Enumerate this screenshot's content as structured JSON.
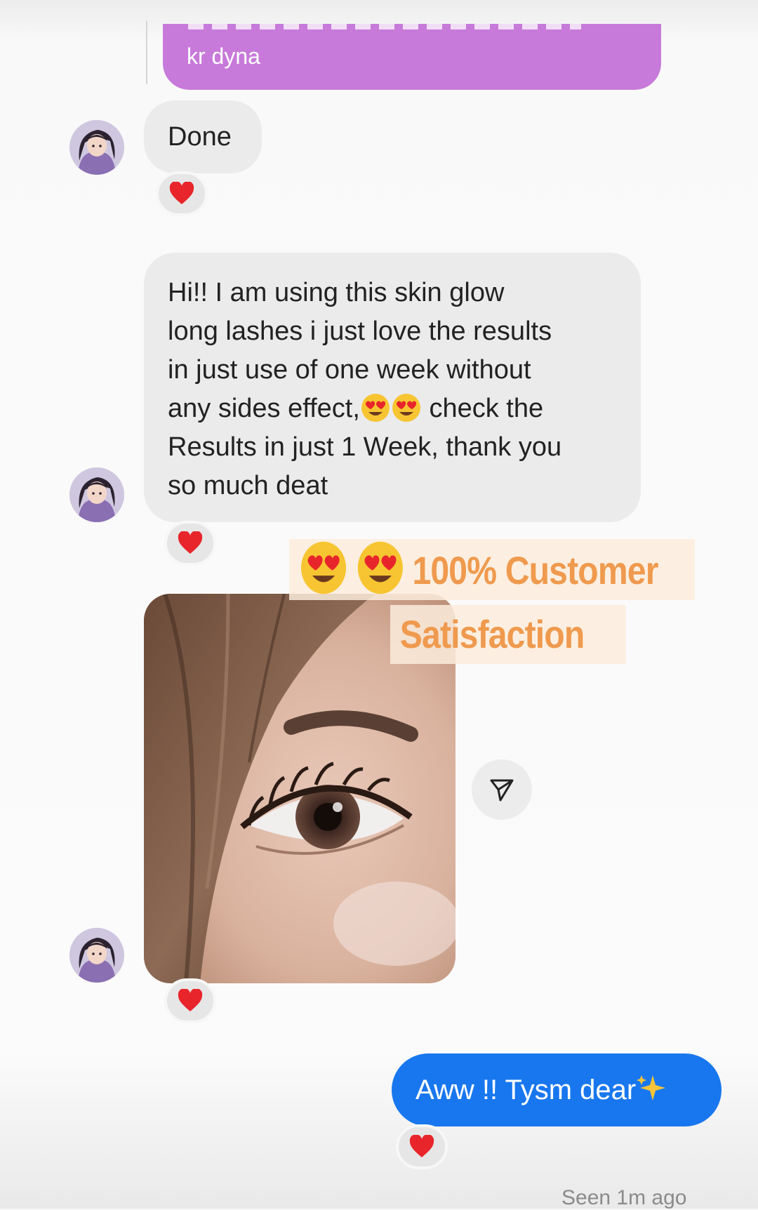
{
  "messages": {
    "outgoing_top": {
      "text": "kr dyna"
    },
    "incoming_done": {
      "text": "Done"
    },
    "incoming_review": {
      "lines": [
        "Hi!! I am using this skin glow",
        "long lashes i just love the results",
        "in just use of one week without",
        "any sides effect,",
        "check the",
        "Results in just 1 Week, thank you",
        "so much deat"
      ]
    },
    "outgoing_reply": {
      "text": "Aww !! Tysm dear"
    },
    "seen_status": "Seen 1m ago"
  },
  "overlay": {
    "line1": "100% Customer",
    "line2": "Satisfaction",
    "color": "#ef9a4e"
  },
  "colors": {
    "outgoing_purple": "#c77ad9",
    "outgoing_blue": "#1877ee",
    "incoming_bubble": "#ebebeb",
    "reaction_heart": "#e8252b"
  },
  "icons": {
    "reaction": "red-heart-icon",
    "share": "paper-plane-icon",
    "emoji": "heart-eyes-emoji",
    "sparkle": "sparkles-emoji"
  }
}
